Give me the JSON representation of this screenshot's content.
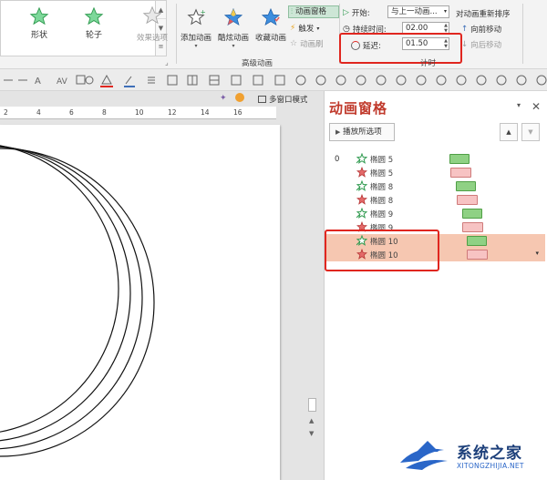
{
  "ribbon": {
    "gallery": [
      {
        "label": "形状",
        "icon": "star-icon"
      },
      {
        "label": "轮子",
        "icon": "star-icon"
      }
    ],
    "effect_options": "效果选项",
    "advanced": {
      "add_animation": "添加动画",
      "cool_animation": "酷炫动画",
      "favorite_animation": "收藏动画",
      "animation_pane": "动画窗格",
      "trigger": "触发",
      "animation_painter": "动画刷",
      "group_label": "高级动画"
    },
    "timing": {
      "start_label": "开始:",
      "start_value": "与上一动画...",
      "duration_label": "持续时间:",
      "duration_value": "02.00",
      "delay_label": "延迟:",
      "delay_value": "01.50",
      "group_label": "计时",
      "reorder_label": "对动画重新排序",
      "move_earlier": "向前移动",
      "move_later": "向后移动"
    }
  },
  "canvas": {
    "view_mode": "多窗口模式",
    "ruler_ticks": [
      "2",
      "4",
      "6",
      "8",
      "10",
      "12",
      "14",
      "16"
    ]
  },
  "pane": {
    "title": "动画窗格",
    "play_selected": "播放所选项",
    "group_number": "0",
    "rows": [
      {
        "label": "椭圆 5",
        "type": "entrance",
        "selected": false
      },
      {
        "label": "椭圆 5",
        "type": "exit",
        "selected": false
      },
      {
        "label": "椭圆 8",
        "type": "entrance",
        "selected": false
      },
      {
        "label": "椭圆 8",
        "type": "exit",
        "selected": false
      },
      {
        "label": "椭圆 9",
        "type": "entrance",
        "selected": false
      },
      {
        "label": "椭圆 9",
        "type": "exit",
        "selected": false
      },
      {
        "label": "椭圆 10",
        "type": "entrance",
        "selected": true
      },
      {
        "label": "椭圆 10",
        "type": "exit",
        "selected": true
      }
    ]
  },
  "watermark": {
    "text": "系统之家",
    "url": "XITONGZHIJIA.NET"
  },
  "colors": {
    "accent_red": "#e0261f",
    "selection": "#f6c7b1",
    "entrance_bar": "#8fd184",
    "exit_bar": "#f7c3c3"
  }
}
